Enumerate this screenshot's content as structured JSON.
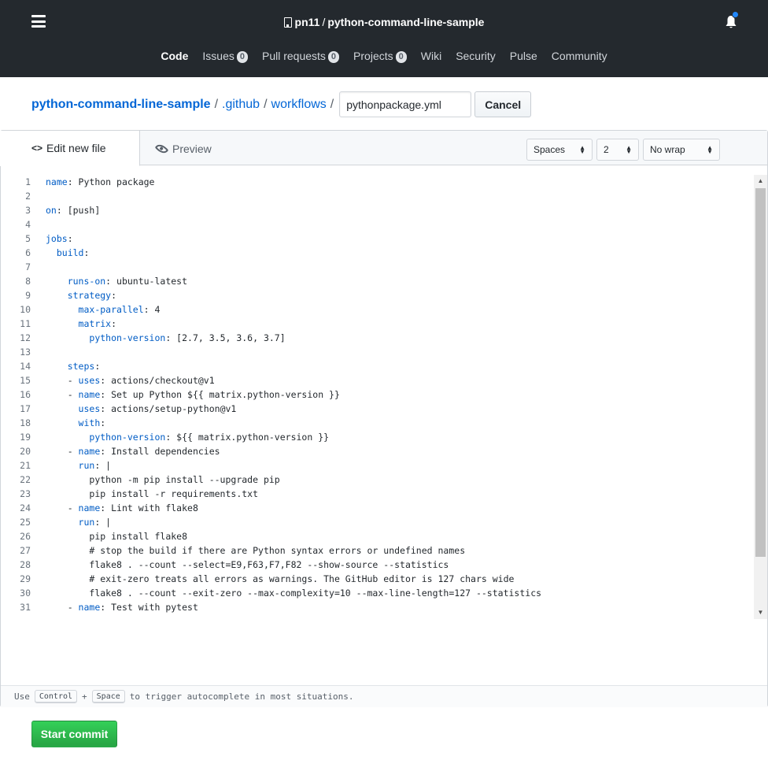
{
  "header": {
    "owner": "pn11",
    "separator": "/",
    "repo": "python-command-line-sample",
    "nav": [
      {
        "label": "Code",
        "count": null
      },
      {
        "label": "Issues",
        "count": "0"
      },
      {
        "label": "Pull requests",
        "count": "0"
      },
      {
        "label": "Projects",
        "count": "0"
      },
      {
        "label": "Wiki",
        "count": null
      },
      {
        "label": "Security",
        "count": null
      },
      {
        "label": "Pulse",
        "count": null
      },
      {
        "label": "Community",
        "count": null
      }
    ]
  },
  "breadcrumb": {
    "root": "python-command-line-sample",
    "folder1": ".github",
    "folder2": "workflows",
    "slash": "/",
    "filename": "pythonpackage.yml",
    "cancel": "Cancel"
  },
  "editor": {
    "tab_edit": "Edit new file",
    "tab_edit_icon": "<>",
    "tab_preview": "Preview",
    "indent_mode": "Spaces",
    "indent_size": "2",
    "wrap_mode": "No wrap",
    "lines": [
      {
        "n": "1",
        "key": "name",
        "rest": ": Python package",
        "indent": ""
      },
      {
        "n": "2",
        "key": "",
        "rest": "",
        "indent": ""
      },
      {
        "n": "3",
        "key": "on",
        "rest": ": [push]",
        "indent": ""
      },
      {
        "n": "4",
        "key": "",
        "rest": "",
        "indent": ""
      },
      {
        "n": "5",
        "key": "jobs",
        "rest": ":",
        "indent": ""
      },
      {
        "n": "6",
        "key": "build",
        "rest": ":",
        "indent": "  "
      },
      {
        "n": "7",
        "key": "",
        "rest": "",
        "indent": ""
      },
      {
        "n": "8",
        "key": "runs-on",
        "rest": ": ubuntu-latest",
        "indent": "    "
      },
      {
        "n": "9",
        "key": "strategy",
        "rest": ":",
        "indent": "    "
      },
      {
        "n": "10",
        "key": "max-parallel",
        "rest": ": 4",
        "indent": "      "
      },
      {
        "n": "11",
        "key": "matrix",
        "rest": ":",
        "indent": "      "
      },
      {
        "n": "12",
        "key": "python-version",
        "rest": ": [2.7, 3.5, 3.6, 3.7]",
        "indent": "        "
      },
      {
        "n": "13",
        "key": "",
        "rest": "",
        "indent": ""
      },
      {
        "n": "14",
        "key": "steps",
        "rest": ":",
        "indent": "    "
      },
      {
        "n": "15",
        "key": "uses",
        "rest": ": actions/checkout@v1",
        "indent": "    - "
      },
      {
        "n": "16",
        "key": "name",
        "rest": ": Set up Python ${{ matrix.python-version }}",
        "indent": "    - "
      },
      {
        "n": "17",
        "key": "uses",
        "rest": ": actions/setup-python@v1",
        "indent": "      "
      },
      {
        "n": "18",
        "key": "with",
        "rest": ":",
        "indent": "      "
      },
      {
        "n": "19",
        "key": "python-version",
        "rest": ": ${{ matrix.python-version }}",
        "indent": "        "
      },
      {
        "n": "20",
        "key": "name",
        "rest": ": Install dependencies",
        "indent": "    - "
      },
      {
        "n": "21",
        "key": "run",
        "rest": ": |",
        "indent": "      "
      },
      {
        "n": "22",
        "key": "",
        "rest": "python -m pip install --upgrade pip",
        "indent": "        "
      },
      {
        "n": "23",
        "key": "",
        "rest": "pip install -r requirements.txt",
        "indent": "        "
      },
      {
        "n": "24",
        "key": "name",
        "rest": ": Lint with flake8",
        "indent": "    - "
      },
      {
        "n": "25",
        "key": "run",
        "rest": ": |",
        "indent": "      "
      },
      {
        "n": "26",
        "key": "",
        "rest": "pip install flake8",
        "indent": "        "
      },
      {
        "n": "27",
        "key": "",
        "rest": "# stop the build if there are Python syntax errors or undefined names",
        "indent": "        "
      },
      {
        "n": "28",
        "key": "",
        "rest": "flake8 . --count --select=E9,F63,F7,F82 --show-source --statistics",
        "indent": "        "
      },
      {
        "n": "29",
        "key": "",
        "rest": "# exit-zero treats all errors as warnings. The GitHub editor is 127 chars wide",
        "indent": "        "
      },
      {
        "n": "30",
        "key": "",
        "rest": "flake8 . --count --exit-zero --max-complexity=10 --max-line-length=127 --statistics",
        "indent": "        "
      },
      {
        "n": "31",
        "key": "name",
        "rest": ": Test with pytest",
        "indent": "    - "
      }
    ],
    "hint_use": "Use",
    "hint_key1": "Control",
    "hint_plus": "+",
    "hint_key2": "Space",
    "hint_rest": "to trigger autocomplete in most situations."
  },
  "commit_button": "Start commit",
  "colors": {
    "header_bg": "#24292e",
    "link": "#0366d6",
    "yaml_key": "#005cc5",
    "commit_green": "#28a745",
    "notification_dot": "#2188ff"
  }
}
